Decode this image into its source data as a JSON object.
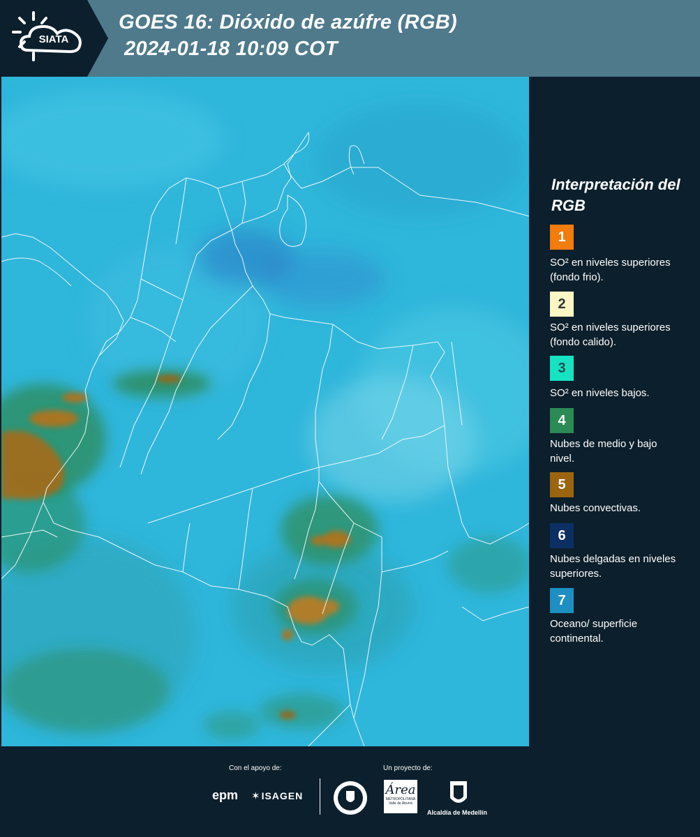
{
  "header": {
    "logo_text": "SIATA",
    "title_line1": "GOES 16: Dióxido de azúfre (RGB)",
    "title_line2": "2024-01-18 10:09 COT"
  },
  "legend": {
    "title": "Interpretación del RGB",
    "items": [
      {
        "number": "1",
        "color": "#f27c0c",
        "label": "SO² en niveles superiores (fondo frio)."
      },
      {
        "number": "2",
        "color": "#fbf7c4",
        "label": "SO² en niveles superiores (fondo calido)."
      },
      {
        "number": "3",
        "color": "#17e3c3",
        "label": "SO² en niveles bajos."
      },
      {
        "number": "4",
        "color": "#2c8a55",
        "label": "Nubes de medio y bajo nivel."
      },
      {
        "number": "5",
        "color": "#9b6510",
        "label": "Nubes convectivas."
      },
      {
        "number": "6",
        "color": "#0b2f62",
        "label": "Nubes delgadas en niveles superiores."
      },
      {
        "number": "7",
        "color": "#1d8fc2",
        "label": "Oceano/ superficie continental."
      }
    ]
  },
  "footer": {
    "support_label": "Con el apoyo de:",
    "project_label": "Un proyecto de:",
    "sponsors": [
      "epm",
      "ISAGEN"
    ],
    "partners": [
      "METROPOLITANA",
      "Valle de Aburrá",
      "Alcaldía de Medellín"
    ]
  },
  "icons": [
    "sun-icon",
    "cloud-icon"
  ]
}
